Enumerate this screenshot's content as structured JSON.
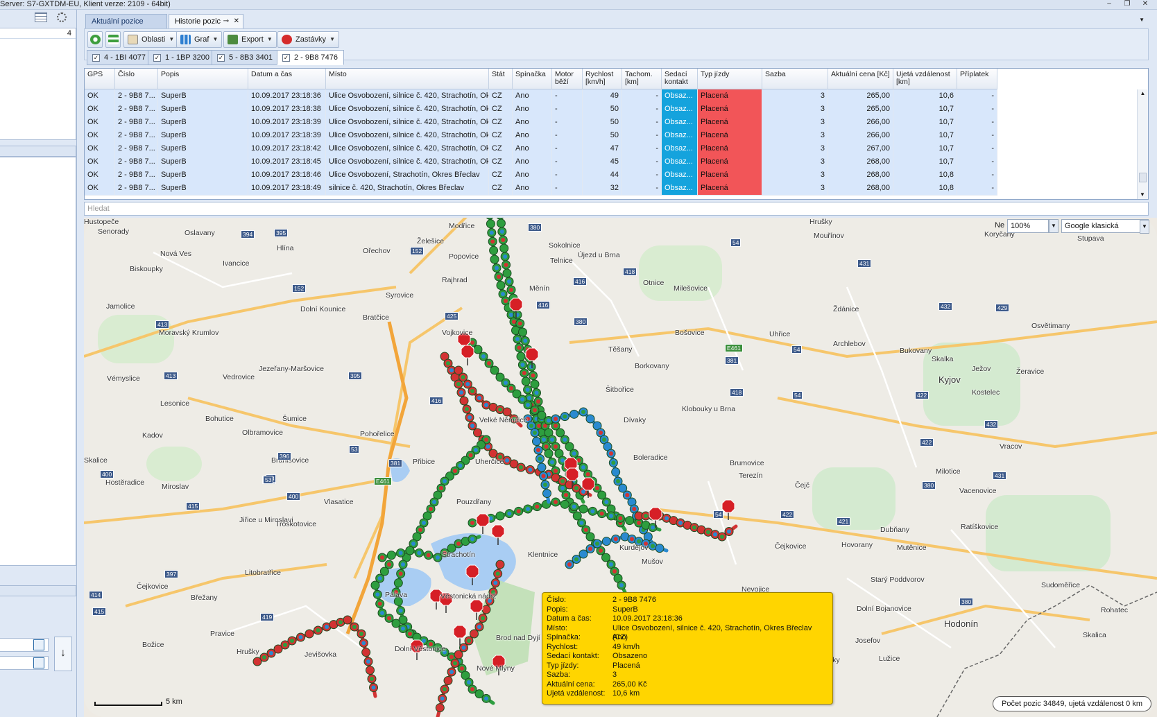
{
  "window": {
    "title": "Server: S7-GXTDM-EU, Klient verze: 2109 - 64bit)",
    "minimize": "‒",
    "restore": "❐",
    "close": "✕"
  },
  "left_panel": {
    "count": "4",
    "arrow_down": "↓"
  },
  "doc_tabs": [
    {
      "label": "Aktuální pozice"
    },
    {
      "label": "Historie pozic",
      "pin": "⊸",
      "close": "✕"
    }
  ],
  "toolbar": {
    "refresh": "",
    "filter": "",
    "oblasti": "Oblasti",
    "graf": "Graf",
    "export": "Export",
    "zastavky": "Zastávky"
  },
  "vehicle_tabs": [
    {
      "label": "4 - 1BI 4077",
      "checked": "✓"
    },
    {
      "label": "1 - 1BP 3200",
      "checked": "✓"
    },
    {
      "label": "5 - 8B3 3401",
      "checked": "✓"
    },
    {
      "label": "2 - 9B8 7476",
      "checked": "✓"
    }
  ],
  "grid": {
    "headers": {
      "gps": "GPS",
      "cislo": "Číslo",
      "popis": "Popis",
      "datum": "Datum a čas",
      "misto": "Místo",
      "stat": "Stát",
      "spinacka": "Spínačka",
      "motor": "Motor běží",
      "rychlost": "Rychlost [km/h]",
      "tachom": "Tachom. [km]",
      "sedaci": "Sedací kontakt",
      "typ": "Typ jízdy",
      "sazba": "Sazba",
      "cena": "Aktuální cena [Kč]",
      "ujeta": "Ujetá vzdálenost [km]",
      "priplatek": "Příplatek"
    },
    "rows": [
      {
        "gps": "OK",
        "cislo": "2 - 9B8 7...",
        "popis": "SuperB",
        "datum": "10.09.2017 23:18:36",
        "misto": "Ulice Osvobození, silnice č. 420, Strachotín, Okr...",
        "stat": "CZ",
        "spinacka": "Ano",
        "motor": "-",
        "rychlost": "49",
        "tachom": "-",
        "sedaci": "Obsaz...",
        "typ": "Placená",
        "sazba": "3",
        "cena": "265,00",
        "ujeta": "10,6",
        "priplatek": "-"
      },
      {
        "gps": "OK",
        "cislo": "2 - 9B8 7...",
        "popis": "SuperB",
        "datum": "10.09.2017 23:18:38",
        "misto": "Ulice Osvobození, silnice č. 420, Strachotín, Okr...",
        "stat": "CZ",
        "spinacka": "Ano",
        "motor": "-",
        "rychlost": "50",
        "tachom": "-",
        "sedaci": "Obsaz...",
        "typ": "Placená",
        "sazba": "3",
        "cena": "265,00",
        "ujeta": "10,7",
        "priplatek": "-"
      },
      {
        "gps": "OK",
        "cislo": "2 - 9B8 7...",
        "popis": "SuperB",
        "datum": "10.09.2017 23:18:39",
        "misto": "Ulice Osvobození, silnice č. 420, Strachotín, Okr...",
        "stat": "CZ",
        "spinacka": "Ano",
        "motor": "-",
        "rychlost": "50",
        "tachom": "-",
        "sedaci": "Obsaz...",
        "typ": "Placená",
        "sazba": "3",
        "cena": "266,00",
        "ujeta": "10,7",
        "priplatek": "-"
      },
      {
        "gps": "OK",
        "cislo": "2 - 9B8 7...",
        "popis": "SuperB",
        "datum": "10.09.2017 23:18:39",
        "misto": "Ulice Osvobození, silnice č. 420, Strachotín, Okr...",
        "stat": "CZ",
        "spinacka": "Ano",
        "motor": "-",
        "rychlost": "50",
        "tachom": "-",
        "sedaci": "Obsaz...",
        "typ": "Placená",
        "sazba": "3",
        "cena": "266,00",
        "ujeta": "10,7",
        "priplatek": "-"
      },
      {
        "gps": "OK",
        "cislo": "2 - 9B8 7...",
        "popis": "SuperB",
        "datum": "10.09.2017 23:18:42",
        "misto": "Ulice Osvobození, silnice č. 420, Strachotín, Okr...",
        "stat": "CZ",
        "spinacka": "Ano",
        "motor": "-",
        "rychlost": "47",
        "tachom": "-",
        "sedaci": "Obsaz...",
        "typ": "Placená",
        "sazba": "3",
        "cena": "267,00",
        "ujeta": "10,7",
        "priplatek": "-"
      },
      {
        "gps": "OK",
        "cislo": "2 - 9B8 7...",
        "popis": "SuperB",
        "datum": "10.09.2017 23:18:45",
        "misto": "Ulice Osvobození, silnice č. 420, Strachotín, Okr...",
        "stat": "CZ",
        "spinacka": "Ano",
        "motor": "-",
        "rychlost": "45",
        "tachom": "-",
        "sedaci": "Obsaz...",
        "typ": "Placená",
        "sazba": "3",
        "cena": "268,00",
        "ujeta": "10,7",
        "priplatek": "-"
      },
      {
        "gps": "OK",
        "cislo": "2 - 9B8 7...",
        "popis": "SuperB",
        "datum": "10.09.2017 23:18:46",
        "misto": "Ulice Osvobození, Strachotín, Okres Břeclav",
        "stat": "CZ",
        "spinacka": "Ano",
        "motor": "-",
        "rychlost": "44",
        "tachom": "-",
        "sedaci": "Obsaz...",
        "typ": "Placená",
        "sazba": "3",
        "cena": "268,00",
        "ujeta": "10,8",
        "priplatek": "-"
      },
      {
        "gps": "OK",
        "cislo": "2 - 9B8 7...",
        "popis": "SuperB",
        "datum": "10.09.2017 23:18:49",
        "misto": "silnice č. 420, Strachotín, Okres Břeclav",
        "stat": "CZ",
        "spinacka": "Ano",
        "motor": "-",
        "rychlost": "32",
        "tachom": "-",
        "sedaci": "Obsaz...",
        "typ": "Placená",
        "sazba": "3",
        "cena": "268,00",
        "ujeta": "10,8",
        "priplatek": "-"
      }
    ],
    "colors": {
      "row_bg": "#d8e7fb",
      "seat_contact": "#14a3dd",
      "paid_trip": "#f25558"
    }
  },
  "search": {
    "placeholder": "Hledat"
  },
  "map": {
    "zoom_prefix": "Ne",
    "zoom": "100%",
    "map_type": "Google klasická",
    "scale": "5 km",
    "status": "Počet pozic 34849, ujetá vzdálenost 0 km",
    "places": [
      "Senorady",
      "Oslavany",
      "Nová Ves",
      "Ivancice",
      "Biskoupky",
      "Hlína",
      "Ořechov",
      "Modřice",
      "Želešice",
      "Popovice",
      "Rajhrad",
      "Syrovice",
      "Dolní Kounice",
      "Jamolice",
      "Moravský Krumlov",
      "Bratčice",
      "Vojkovice",
      "Jezeřany-Maršovice",
      "Vémyslice",
      "Vedrovice",
      "Lesonice",
      "Bohutice",
      "Šumice",
      "Olbramovice",
      "Kadov",
      "Pohořelice",
      "Skalice",
      "Branišovice",
      "Přibice",
      "Hostěradice",
      "Miroslav",
      "Vlasatice",
      "Jiřice u Miroslavi",
      "Troskotovice",
      "Litobratřice",
      "Čejkovice",
      "Břežany",
      "Pravice",
      "Božice",
      "Jevišovka",
      "Hrušky",
      "Sokolnice",
      "Telnice",
      "Újezd u Brna",
      "Měnín",
      "Otnice",
      "Milešovice",
      "Těšany",
      "Borkovany",
      "Šitbořice",
      "Bošovice",
      "Klobouky u Brna",
      "Dívaky",
      "Boleradice",
      "Brumovice",
      "Pouzdřany",
      "Uherčice",
      "Velké Němčice",
      "Ždánice",
      "Uhřice",
      "Archlebov",
      "Bukovany",
      "Kyjov",
      "Skalka",
      "Ježov",
      "Žeravice",
      "Kostelec",
      "Vracov",
      "Milotice",
      "Vacenovice",
      "Ratíškovice",
      "Dubňany",
      "Mutěnice",
      "Hovorany",
      "Terezín",
      "Čejč",
      "Čejkovice",
      "Starý Poddvorov",
      "Dolní Bojanovice",
      "Josefov",
      "Lužice",
      "Hodonín",
      "Rohatec",
      "Sudoměřice",
      "Skalica",
      "Prušánky",
      "Koryčany",
      "Stupava",
      "Osvětimany",
      "Mouřínov",
      "Hrušky",
      "Nevojice",
      "Mušov",
      "Kurdějov",
      "Strachotín",
      "Věstonická nádrž",
      "Pálava",
      "Dolní Věstonice",
      "Brod nad Dyjí",
      "Nové Mlýny",
      "Klentnice",
      "Hustopeče"
    ],
    "roads": [
      "394",
      "395",
      "152",
      "152",
      "380",
      "416",
      "416",
      "418",
      "54",
      "431",
      "432",
      "429",
      "413",
      "425",
      "380",
      "E461",
      "416",
      "418",
      "381",
      "395",
      "413",
      "396",
      "53",
      "381",
      "E461",
      "415",
      "400",
      "53",
      "400",
      "415",
      "53",
      "397",
      "414",
      "415",
      "419",
      "54",
      "54",
      "422",
      "432",
      "422",
      "422",
      "431",
      "380",
      "421",
      "54",
      "380"
    ]
  },
  "tooltip": {
    "rows": [
      {
        "k": "Číslo:",
        "v": "2 - 9B8 7476"
      },
      {
        "k": "Popis:",
        "v": "SuperB"
      },
      {
        "k": "Datum a čas:",
        "v": "10.09.2017 23:18:36"
      },
      {
        "k": "Místo:",
        "v": "Ulice Osvobození, silnice č. 420, Strachotín, Okres Břeclav (CZ)"
      },
      {
        "k": "Spínačka:",
        "v": "Ano"
      },
      {
        "k": "Rychlost:",
        "v": "49 km/h"
      },
      {
        "k": "Sedací kontakt:",
        "v": "Obsazeno"
      },
      {
        "k": "Typ jízdy:",
        "v": "Placená"
      },
      {
        "k": "Sazba:",
        "v": "3"
      },
      {
        "k": "Aktuální cena:",
        "v": "265,00 Kč"
      },
      {
        "k": "Ujetá vzdálenost:",
        "v": "10,6 km"
      }
    ],
    "color": "#ffd500"
  }
}
